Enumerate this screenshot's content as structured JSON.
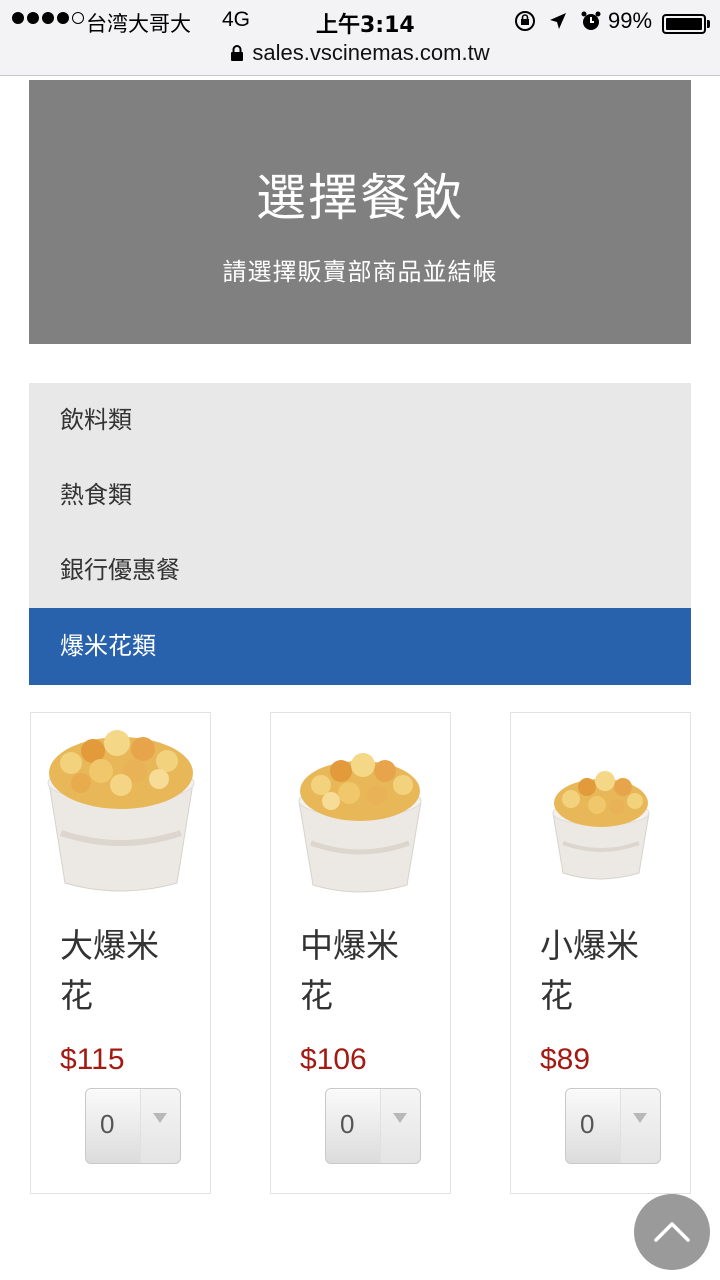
{
  "status_bar": {
    "carrier": "台湾大哥大",
    "network": "4G",
    "time": "上午3:14",
    "battery": "99%",
    "url": "sales.vscinemas.com.tw"
  },
  "hero": {
    "title": "選擇餐飲",
    "subtitle": "請選擇販賣部商品並結帳"
  },
  "categories": [
    {
      "label": "飲料類",
      "active": false
    },
    {
      "label": "熱食類",
      "active": false
    },
    {
      "label": "銀行優惠餐",
      "active": false
    },
    {
      "label": "爆米花類",
      "active": true
    }
  ],
  "products": [
    {
      "name": "大爆米花",
      "price": "$115",
      "quantity": "0",
      "image": "popcorn-large"
    },
    {
      "name": "中爆米花",
      "price": "$106",
      "quantity": "0",
      "image": "popcorn-medium"
    },
    {
      "name": "小爆米花",
      "price": "$89",
      "quantity": "0",
      "image": "popcorn-small"
    }
  ],
  "colors": {
    "hero_bg": "#808080",
    "menu_bg": "#e8e8e8",
    "active_bg": "#2862ad",
    "price": "#a31a12"
  }
}
